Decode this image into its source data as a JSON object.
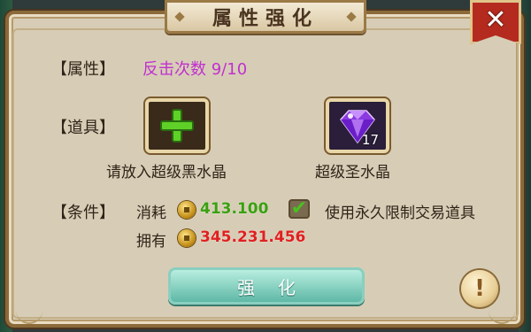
{
  "dialog": {
    "title": "属性强化",
    "close_symbol": "✕"
  },
  "attribute": {
    "label": "【属性】",
    "value": "反击次数 9/10"
  },
  "items": {
    "label": "【道具】",
    "slot_empty_caption": "请放入超级黑水晶",
    "slot_crystal_caption": "超级圣水晶",
    "crystal_count": "17",
    "slot_empty_icon": "green-plus-icon",
    "slot_crystal_icon": "purple-diamond-icon"
  },
  "conditions": {
    "label": "【条件】",
    "cost_label": "消耗",
    "cost_value": "413.100",
    "owned_label": "拥有",
    "owned_value": "345.231.456",
    "checkbox_label": "使用永久限制交易道具",
    "checkbox_checked": true
  },
  "actions": {
    "enhance_label": "强化",
    "help_symbol": "!"
  },
  "colors": {
    "attribute_value": "#c030d0",
    "cost_value": "#3aa010",
    "owned_value": "#e02020",
    "close_button": "#b52a1e",
    "enhance_button": "#5fb8a6"
  }
}
